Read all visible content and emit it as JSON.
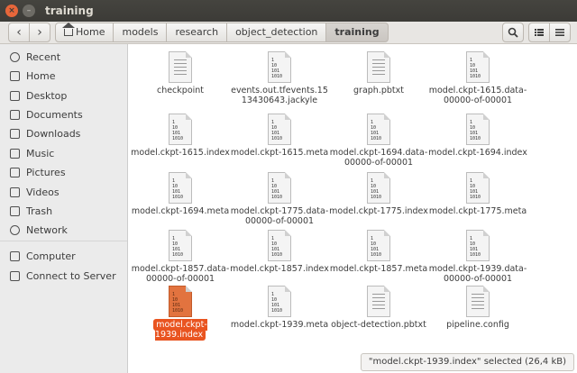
{
  "window": {
    "title": "training"
  },
  "breadcrumbs": [
    "Home",
    "models",
    "research",
    "object_detection",
    "training"
  ],
  "sidebar": {
    "items": [
      {
        "label": "Recent",
        "icon": "clock-icon"
      },
      {
        "label": "Home",
        "icon": "home-icon"
      },
      {
        "label": "Desktop",
        "icon": "desktop-folder-icon"
      },
      {
        "label": "Documents",
        "icon": "documents-folder-icon"
      },
      {
        "label": "Downloads",
        "icon": "downloads-folder-icon"
      },
      {
        "label": "Music",
        "icon": "music-folder-icon"
      },
      {
        "label": "Pictures",
        "icon": "pictures-folder-icon"
      },
      {
        "label": "Videos",
        "icon": "videos-folder-icon"
      },
      {
        "label": "Trash",
        "icon": "trash-icon"
      },
      {
        "label": "Network",
        "icon": "network-icon"
      },
      {
        "label": "Computer",
        "icon": "computer-icon"
      },
      {
        "label": "Connect to Server",
        "icon": "server-icon"
      }
    ]
  },
  "files": [
    {
      "name": "checkpoint",
      "kind": "text"
    },
    {
      "name": "events.out.tfevents.1513430643.jackyle",
      "kind": "binary"
    },
    {
      "name": "graph.pbtxt",
      "kind": "text"
    },
    {
      "name": "model.ckpt-1615.data-00000-of-00001",
      "kind": "binary"
    },
    {
      "name": "model.ckpt-1615.index",
      "kind": "binary"
    },
    {
      "name": "model.ckpt-1615.meta",
      "kind": "binary"
    },
    {
      "name": "model.ckpt-1694.data-00000-of-00001",
      "kind": "binary"
    },
    {
      "name": "model.ckpt-1694.index",
      "kind": "binary"
    },
    {
      "name": "model.ckpt-1694.meta",
      "kind": "binary"
    },
    {
      "name": "model.ckpt-1775.data-00000-of-00001",
      "kind": "binary"
    },
    {
      "name": "model.ckpt-1775.index",
      "kind": "binary"
    },
    {
      "name": "model.ckpt-1775.meta",
      "kind": "binary"
    },
    {
      "name": "model.ckpt-1857.data-00000-of-00001",
      "kind": "binary"
    },
    {
      "name": "model.ckpt-1857.index",
      "kind": "binary"
    },
    {
      "name": "model.ckpt-1857.meta",
      "kind": "binary"
    },
    {
      "name": "model.ckpt-1939.data-00000-of-00001",
      "kind": "binary"
    },
    {
      "name": "model.ckpt-1939.index",
      "kind": "binary",
      "selected": true
    },
    {
      "name": "model.ckpt-1939.meta",
      "kind": "binary"
    },
    {
      "name": "object-detection.pbtxt",
      "kind": "text"
    },
    {
      "name": "pipeline.config",
      "kind": "text"
    }
  ],
  "binary_glyph": "1\n10\n101\n1010",
  "status": {
    "text": "\"model.ckpt-1939.index\" selected  (26,4 kB)"
  },
  "colors": {
    "accent": "#e95420",
    "titlebar": "#3c3b37",
    "close": "#e7663a"
  }
}
